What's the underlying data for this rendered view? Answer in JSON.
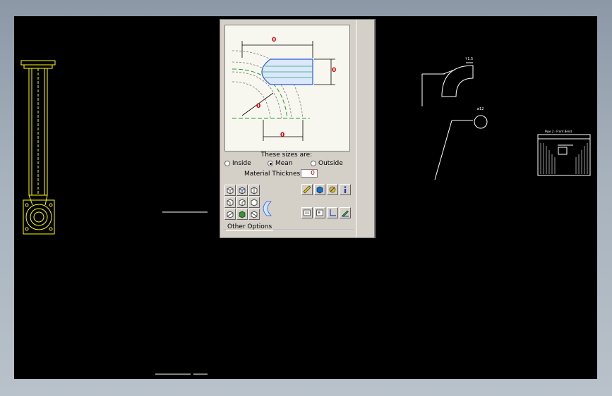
{
  "dialog": {
    "preview_dims": {
      "top_width": "0",
      "right_height": "0",
      "bend_radius": "0",
      "bottom_width": "0"
    },
    "sizes_title": "These sizes are:",
    "options": [
      {
        "label": "Inside",
        "selected": false
      },
      {
        "label": "Mean",
        "selected": true
      },
      {
        "label": "Outside",
        "selected": false
      }
    ],
    "thickness_label": "Material Thickness",
    "thickness_value": "0",
    "other_options_label": "Other Options",
    "toolbar_left_icons": [
      "view-front-icon",
      "view-iso-icon",
      "view-top-icon",
      "view-left-icon",
      "view-right-icon",
      "view-back-icon",
      "view-bottom-icon",
      "view-isoleft-icon",
      "view-isoright-icon"
    ],
    "toolbar_right_top_icons": [
      "ruler-icon",
      "material-cube-icon",
      "fastener-icon",
      "info-icon"
    ],
    "toolbar_right_bottom_icons": [
      "sheet-icon",
      "drawing-view-icon",
      "axis-icon",
      "pencil-flange-icon"
    ]
  },
  "drawing": {
    "elbow_label": "↑1.5",
    "circle_label": "ø12",
    "small_table_title": "Pipe 2 - Front Bend"
  },
  "colors": {
    "canvas": "#000000",
    "cad_line": "#ffff00",
    "white_line": "#ffffff",
    "dim_red": "#d00000",
    "pipe_blue": "#2a5bd7",
    "panel": "#d4d0c8"
  }
}
